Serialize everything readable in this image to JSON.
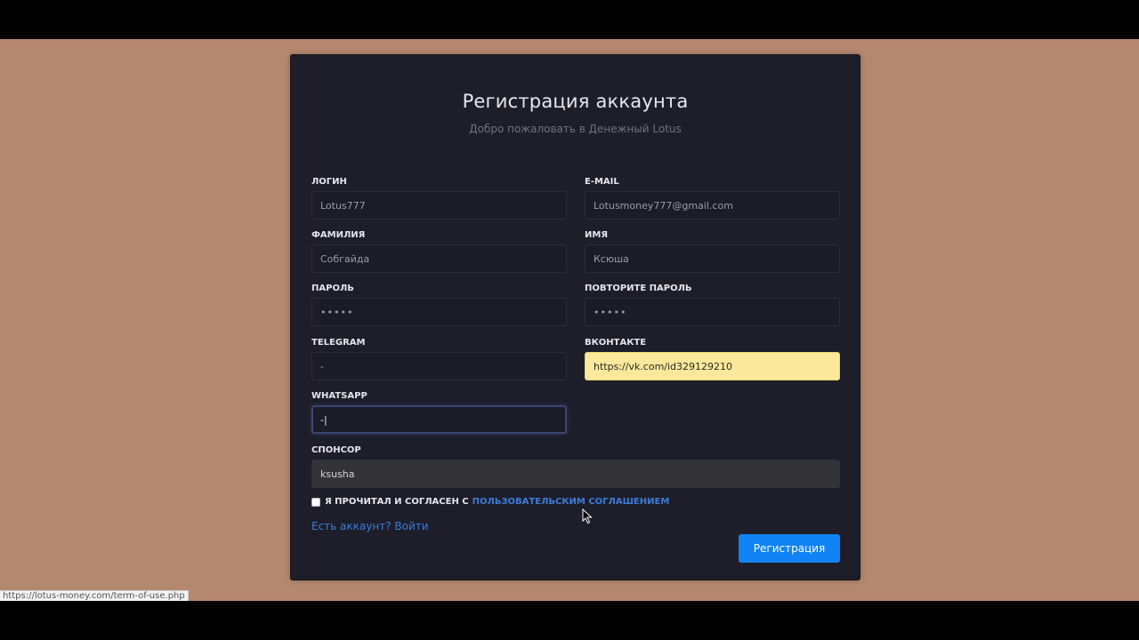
{
  "card": {
    "title": "Регистрация аккаунта",
    "subtitle": "Добро пожаловать в Денежный Lotus"
  },
  "fields": {
    "login": {
      "label": "ЛОГИН",
      "value": "Lotus777"
    },
    "email": {
      "label": "E-MAIL",
      "value": "Lotusmoney777@gmail.com"
    },
    "lastname": {
      "label": "ФАМИЛИЯ",
      "value": "Собгайда"
    },
    "firstname": {
      "label": "ИМЯ",
      "value": "Ксюша"
    },
    "password": {
      "label": "ПАРОЛЬ",
      "value": "•••••"
    },
    "password_repeat": {
      "label": "ПОВТОРИТЕ ПАРОЛЬ",
      "value": "•••••"
    },
    "telegram": {
      "label": "TELEGRAM",
      "value": "-"
    },
    "vkontakte": {
      "label": "ВКОНТАКТЕ",
      "value": "https://vk.com/id329129210"
    },
    "whatsapp": {
      "label": "WHATSAPP",
      "value": "-|"
    },
    "sponsor": {
      "label": "СПОНСОР",
      "value": "ksusha"
    }
  },
  "agreement": {
    "text": "Я ПРОЧИТАЛ И СОГЛАСЕН С",
    "link": "ПОЛЬЗОВАТЕЛЬСКИМ СОГЛАШЕНИЕМ",
    "checked": false
  },
  "login_link": "Есть аккаунт? Войти",
  "submit_label": "Регистрация",
  "status_bar_url": "https://lotus-money.com/term-of-use.php",
  "colors": {
    "background": "#b4876f",
    "card": "#1d1e29",
    "accent": "#1184f5",
    "link": "#3d7bd9",
    "autofill": "#fbe89a"
  }
}
